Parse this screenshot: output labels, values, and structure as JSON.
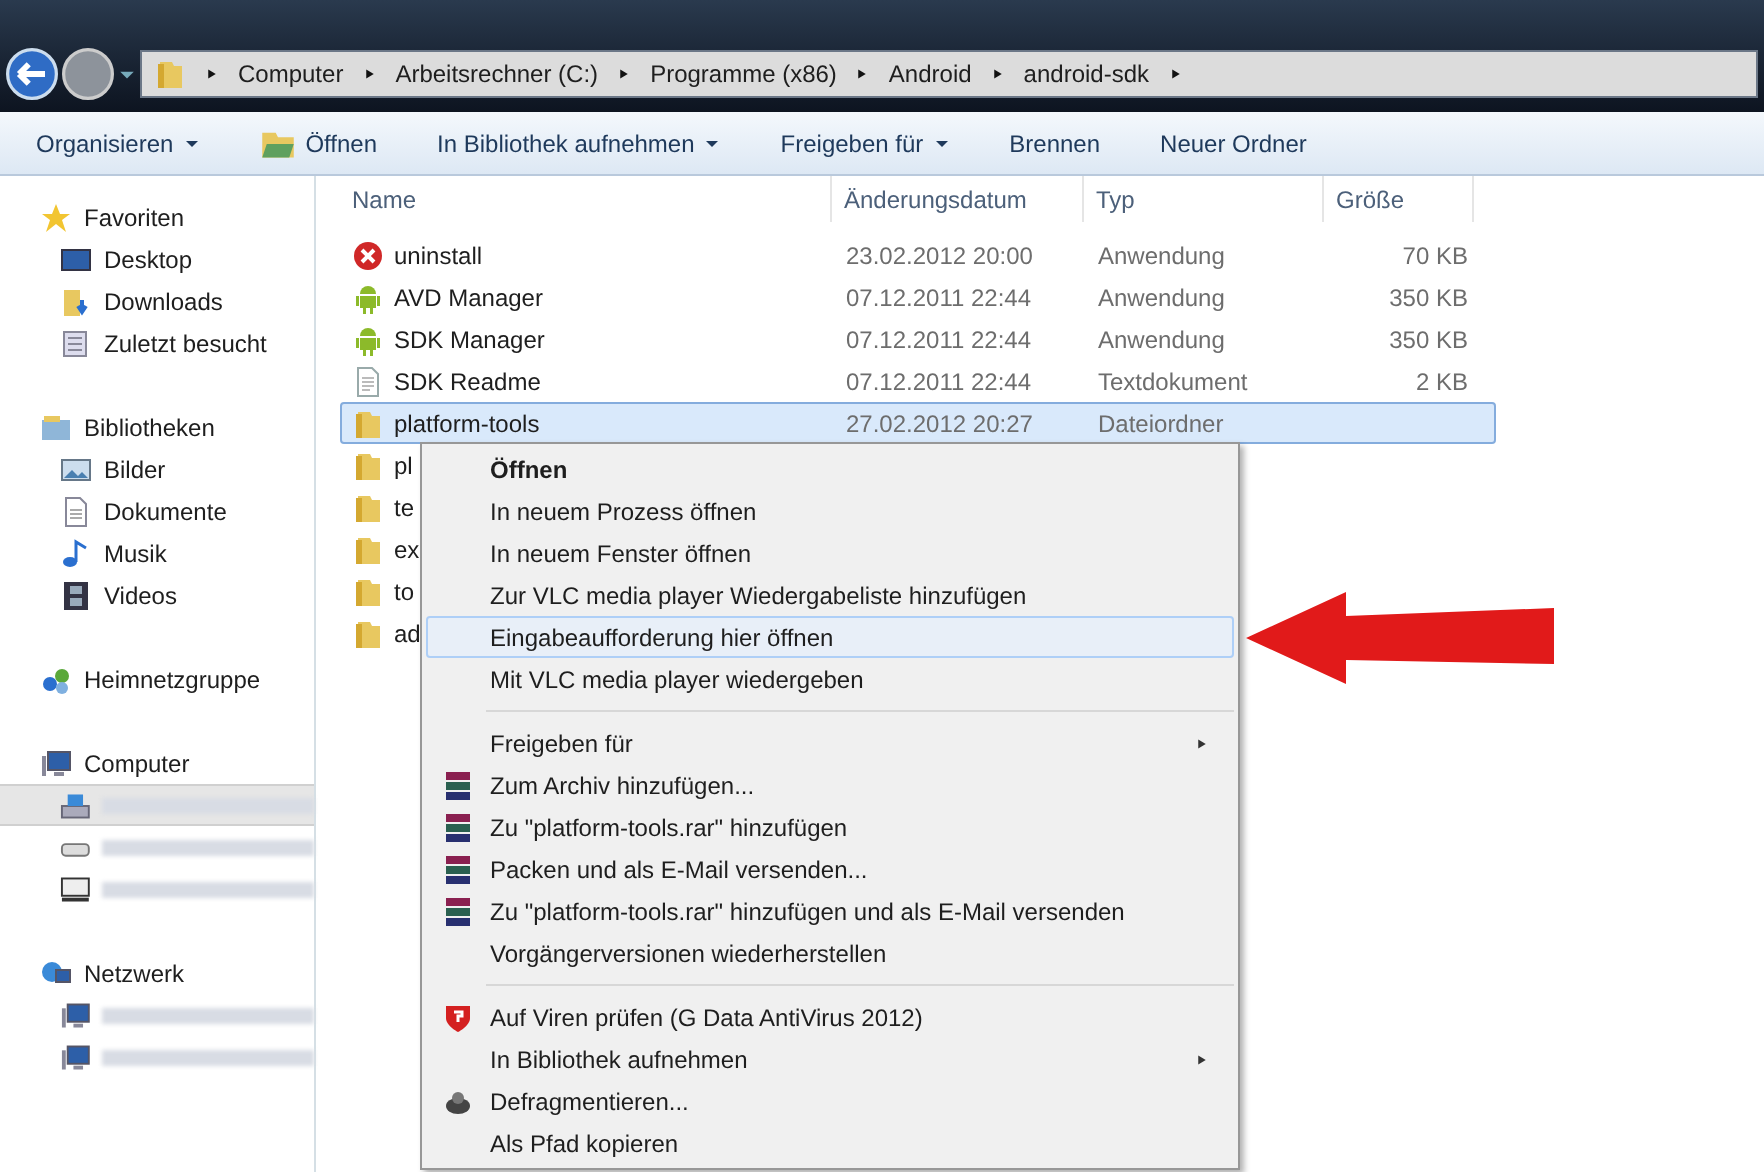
{
  "breadcrumb": [
    "Computer",
    "Arbeitsrechner (C:)",
    "Programme (x86)",
    "Android",
    "android-sdk"
  ],
  "toolbar": [
    {
      "label": "Organisieren",
      "dropdown": true,
      "icon": false
    },
    {
      "label": "Öffnen",
      "dropdown": false,
      "icon": true
    },
    {
      "label": "In Bibliothek aufnehmen",
      "dropdown": true,
      "icon": false
    },
    {
      "label": "Freigeben für",
      "dropdown": true,
      "icon": false
    },
    {
      "label": "Brennen",
      "dropdown": false,
      "icon": false
    },
    {
      "label": "Neuer Ordner",
      "dropdown": false,
      "icon": false
    }
  ],
  "sidebar": [
    {
      "label": "Favoriten",
      "kind": "star",
      "children": [
        {
          "label": "Desktop",
          "kind": "desktop"
        },
        {
          "label": "Downloads",
          "kind": "downloads"
        },
        {
          "label": "Zuletzt besucht",
          "kind": "recent"
        }
      ]
    },
    {
      "label": "Bibliotheken",
      "kind": "library",
      "children": [
        {
          "label": "Bilder",
          "kind": "pictures"
        },
        {
          "label": "Dokumente",
          "kind": "document"
        },
        {
          "label": "Musik",
          "kind": "music"
        },
        {
          "label": "Videos",
          "kind": "video"
        }
      ]
    },
    {
      "label": "Heimnetzgruppe",
      "kind": "homegroup"
    },
    {
      "label": "Computer",
      "kind": "computer",
      "children": [
        {
          "kind": "drive",
          "selected": true
        },
        {
          "kind": "dvd",
          "selected": false
        },
        {
          "kind": "netdrive",
          "selected": false
        }
      ]
    },
    {
      "label": "Netzwerk",
      "kind": "network",
      "children": [
        {
          "kind": "computer"
        },
        {
          "kind": "computer"
        }
      ]
    }
  ],
  "columns": [
    "Name",
    "Änderungsdatum",
    "Typ",
    "Größe"
  ],
  "files": [
    {
      "name": "uninstall",
      "kind": "uninstall",
      "date": "23.02.2012 20:00",
      "type": "Anwendung",
      "size": "70 KB",
      "selected": false
    },
    {
      "name": "AVD Manager",
      "kind": "android",
      "date": "07.12.2011 22:44",
      "type": "Anwendung",
      "size": "350 KB",
      "selected": false
    },
    {
      "name": "SDK Manager",
      "kind": "android",
      "date": "07.12.2011 22:44",
      "type": "Anwendung",
      "size": "350 KB",
      "selected": false
    },
    {
      "name": "SDK Readme",
      "kind": "text",
      "date": "07.12.2011 22:44",
      "type": "Textdokument",
      "size": "2 KB",
      "selected": false
    },
    {
      "name": "platform-tools",
      "kind": "folder",
      "date": "27.02.2012 20:27",
      "type": "Dateiordner",
      "selected": true
    },
    {
      "name": "pl",
      "kind": "folder",
      "selected": false
    },
    {
      "name": "te",
      "kind": "folder",
      "selected": false
    },
    {
      "name": "ex",
      "kind": "folder",
      "selected": false
    },
    {
      "name": "to",
      "kind": "folder",
      "selected": false
    },
    {
      "name": "ad",
      "kind": "folder",
      "selected": false
    }
  ],
  "context_menu": [
    {
      "kind": "plain",
      "label": "Öffnen",
      "bold": true,
      "submenu": false,
      "selected": false
    },
    {
      "kind": "plain",
      "label": "In neuem Prozess öffnen",
      "bold": false,
      "submenu": false,
      "selected": false
    },
    {
      "kind": "plain",
      "label": "In neuem Fenster öffnen",
      "bold": false,
      "submenu": false,
      "selected": false
    },
    {
      "kind": "plain",
      "label": "Zur VLC media player Wiedergabeliste hinzufügen",
      "bold": false,
      "submenu": false,
      "selected": false
    },
    {
      "kind": "plain",
      "label": "Eingabeaufforderung hier öffnen",
      "bold": false,
      "submenu": false,
      "selected": true
    },
    {
      "kind": "plain",
      "label": "Mit VLC media player wiedergeben",
      "bold": false,
      "submenu": false,
      "selected": false
    },
    {
      "kind": "separator"
    },
    {
      "kind": "plain",
      "label": "Freigeben für",
      "bold": false,
      "submenu": true,
      "selected": false
    },
    {
      "kind": "archive",
      "label": "Zum Archiv hinzufügen...",
      "bold": false,
      "submenu": false,
      "selected": false
    },
    {
      "kind": "archive",
      "label": "Zu \"platform-tools.rar\" hinzufügen",
      "bold": false,
      "submenu": false,
      "selected": false
    },
    {
      "kind": "archive",
      "label": "Packen und als E-Mail versenden...",
      "bold": false,
      "submenu": false,
      "selected": false
    },
    {
      "kind": "archive",
      "label": "Zu \"platform-tools.rar\" hinzufügen und als E-Mail versenden",
      "bold": false,
      "submenu": false,
      "selected": false
    },
    {
      "kind": "plain",
      "label": "Vorgängerversionen wiederherstellen",
      "bold": false,
      "submenu": false,
      "selected": false
    },
    {
      "kind": "separator"
    },
    {
      "kind": "antivirus",
      "label": "Auf Viren prüfen (G Data AntiVirus 2012)",
      "bold": false,
      "submenu": false,
      "selected": false
    },
    {
      "kind": "plain",
      "label": "In Bibliothek aufnehmen",
      "bold": false,
      "submenu": true,
      "selected": false
    },
    {
      "kind": "defrag",
      "label": "Defragmentieren...",
      "bold": false,
      "submenu": false,
      "selected": false
    },
    {
      "kind": "plain",
      "label": "Als Pfad kopieren",
      "bold": false,
      "submenu": false,
      "selected": false
    }
  ]
}
